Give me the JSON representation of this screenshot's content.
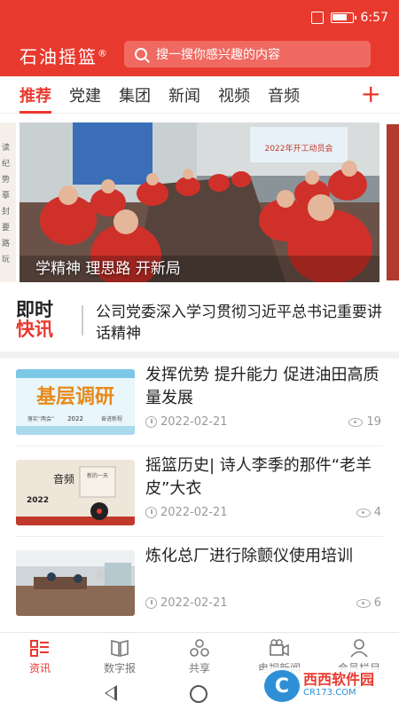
{
  "status_bar": {
    "time": "6:57"
  },
  "header": {
    "brand": "石油摇篮",
    "brand_mark": "®",
    "search_placeholder": "搜一搜你感兴趣的内容"
  },
  "tabs": [
    {
      "label": "推荐",
      "active": true
    },
    {
      "label": "党建"
    },
    {
      "label": "集团"
    },
    {
      "label": "新闻"
    },
    {
      "label": "视频"
    },
    {
      "label": "音频"
    }
  ],
  "banner": {
    "caption": "学精神 理思路 开新局",
    "screen_title": "2022年开工动员会",
    "left_peek_text": "读 纪 势 摹 封 要 路 玩"
  },
  "flash": {
    "logo_line1": "即时",
    "logo_line2": "快讯",
    "headline": "公司党委深入学习贯彻习近平总书记重要讲话精神"
  },
  "news": [
    {
      "title": "发挥优势 提升能力 促进油田高质量发展",
      "date": "2022-02-21",
      "views": "19",
      "thumb_text": "基层调研",
      "thumb_sub": "2022",
      "thumb_tag1": "落实“两会”",
      "thumb_tag2": "奋进新程"
    },
    {
      "title": "摇篮历史| 诗人李季的那件“老羊皮”大衣",
      "date": "2022-02-21",
      "views": "4",
      "thumb_text": "音频",
      "thumb_sub": "2022",
      "thumb_tag1": "新的一天"
    },
    {
      "title": "炼化总厂进行除颤仪使用培训",
      "date": "2022-02-21",
      "views": "6"
    }
  ],
  "bottom_nav": [
    {
      "label": "资讯",
      "icon": "news-list-icon",
      "active": true
    },
    {
      "label": "数字报",
      "icon": "newspaper-icon"
    },
    {
      "label": "共享",
      "icon": "share-icon"
    },
    {
      "label": "电视新闻",
      "icon": "camera-icon"
    },
    {
      "label": "会员栏目",
      "icon": "user-icon"
    }
  ],
  "watermark": {
    "badge": "C",
    "name": "西西软件园",
    "domain": "CR173.COM"
  },
  "colors": {
    "brand_red": "#e8392e"
  }
}
